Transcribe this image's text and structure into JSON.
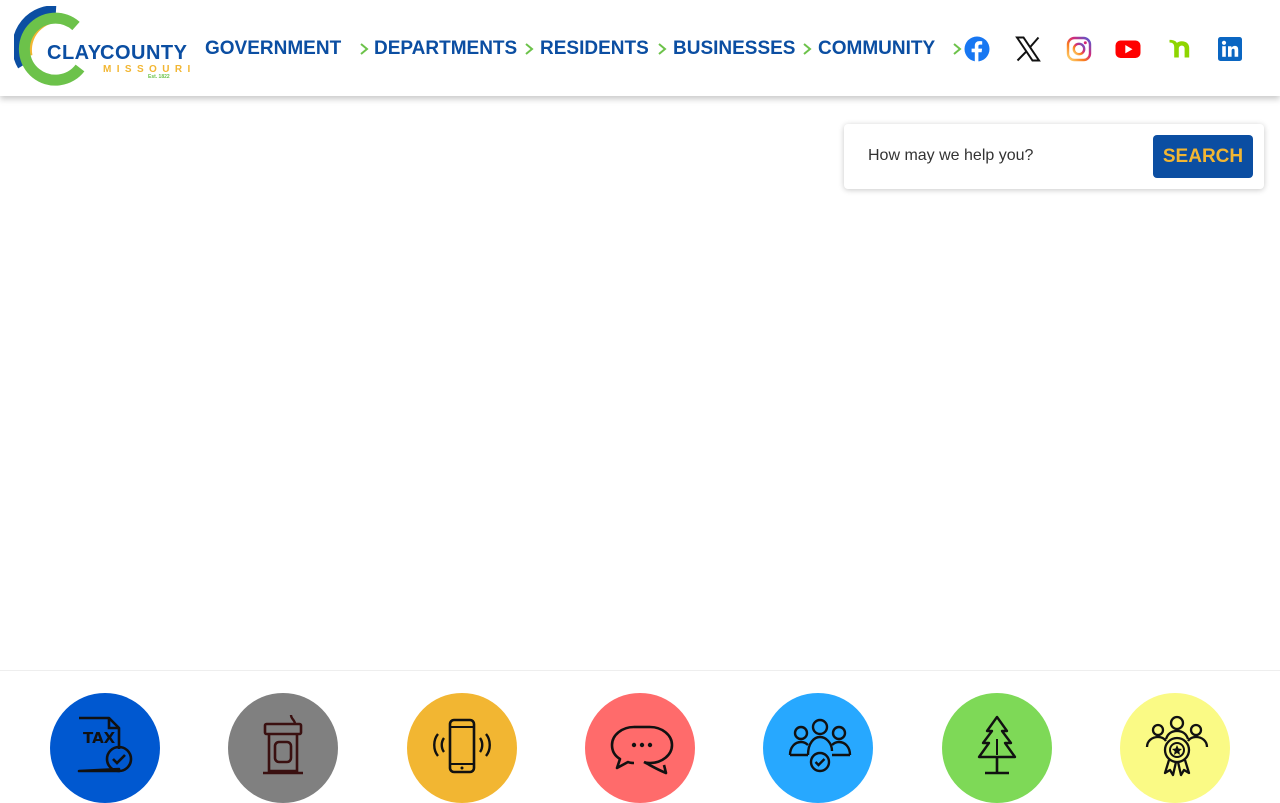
{
  "logo": {
    "name_part1": "CLAY",
    "name_part2": "COUNTY",
    "state": "MISSOURI",
    "established": "Est. 1822"
  },
  "nav": {
    "items": [
      {
        "label": "GOVERNMENT"
      },
      {
        "label": "DEPARTMENTS"
      },
      {
        "label": "RESIDENTS"
      },
      {
        "label": "BUSINESSES"
      },
      {
        "label": "COMMUNITY"
      }
    ]
  },
  "social": [
    {
      "icon": "facebook-icon",
      "color": "#1877f2"
    },
    {
      "icon": "x-twitter-icon",
      "color": "#111111"
    },
    {
      "icon": "instagram-icon",
      "color": "#d6249f"
    },
    {
      "icon": "youtube-icon",
      "color": "#ff0000"
    },
    {
      "icon": "nextdoor-icon",
      "color": "#8ed500"
    },
    {
      "icon": "linkedin-icon",
      "color": "#0a66c2"
    }
  ],
  "search": {
    "placeholder": "How may we help you?",
    "button_label": "SEARCH"
  },
  "quick_links": [
    {
      "icon": "tax-document-icon",
      "color": "#0058d0"
    },
    {
      "icon": "podium-icon",
      "color": "#808080"
    },
    {
      "icon": "mobile-alert-icon",
      "color": "#f2b632"
    },
    {
      "icon": "chat-bubbles-icon",
      "color": "#ff6b6b"
    },
    {
      "icon": "group-check-icon",
      "color": "#27a8ff"
    },
    {
      "icon": "pine-tree-icon",
      "color": "#7ed957"
    },
    {
      "icon": "award-group-icon",
      "color": "#fafa85"
    }
  ],
  "colors": {
    "brand_blue": "#0b4ea2",
    "brand_gold": "#f2b632",
    "brand_green": "#6cc24a"
  }
}
